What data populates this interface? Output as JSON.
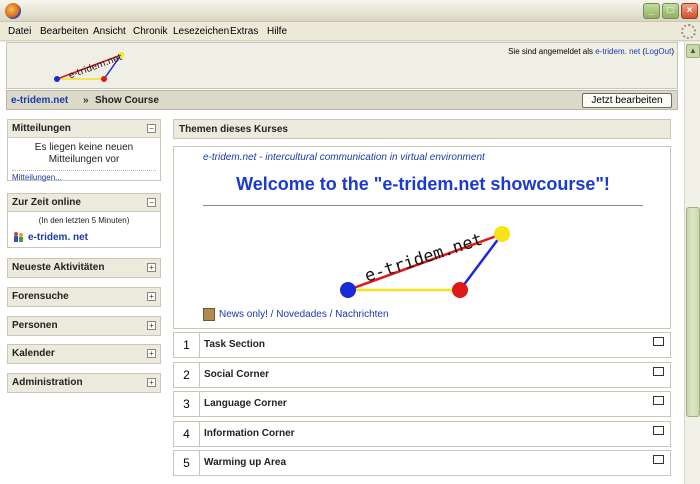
{
  "browser": {
    "menu": [
      "Datei",
      "Bearbeiten",
      "Ansicht",
      "Chronik",
      "Lesezeichen",
      "Extras",
      "Hilfe"
    ]
  },
  "header": {
    "logo_text": "e-tridem.net",
    "login_prefix": "Sie sind angemeldet als",
    "login_user": "e-tridem. net",
    "logout_label": "LogOut"
  },
  "navbar": {
    "home": "e-tridem.net",
    "separator": "»",
    "current": "Show Course",
    "edit_button": "Jetzt bearbeiten"
  },
  "blocks": {
    "messages": {
      "title": "Mitteilungen",
      "text": "Es liegen keine neuen Mitteilungen vor",
      "link": "Mitteilungen..."
    },
    "online": {
      "title": "Zur Zeit online",
      "note": "(In den letzten 5 Minuten)",
      "user": "e-tridem. net"
    },
    "collapsed": [
      "Neueste Aktivitäten",
      "Forensuche",
      "Personen",
      "Kalender",
      "Administration"
    ]
  },
  "main": {
    "topics_title": "Themen dieses Kurses",
    "intro_subtitle": "e-tridem.net - intercultural communication in virtual environment",
    "intro_title": "Welcome to the \"e-tridem.net showcourse\"!",
    "news_link": "News only! / Novedades / Nachrichten",
    "sections": [
      {
        "num": "1",
        "title": "Task Section"
      },
      {
        "num": "2",
        "title": "Social Corner"
      },
      {
        "num": "3",
        "title": "Language Corner"
      },
      {
        "num": "4",
        "title": "Information Corner"
      },
      {
        "num": "5",
        "title": "Warming up Area"
      }
    ]
  },
  "colors": {
    "link": "#1a3aaa",
    "title_blue": "#1a3ad0",
    "logo_blue": "#1a2ad8",
    "logo_red": "#e01818",
    "logo_yellow": "#f4e418"
  },
  "icons": {
    "browser": "firefox-icon",
    "toggle_open": "minus",
    "toggle_closed": "plus",
    "news": "forum-icon"
  }
}
